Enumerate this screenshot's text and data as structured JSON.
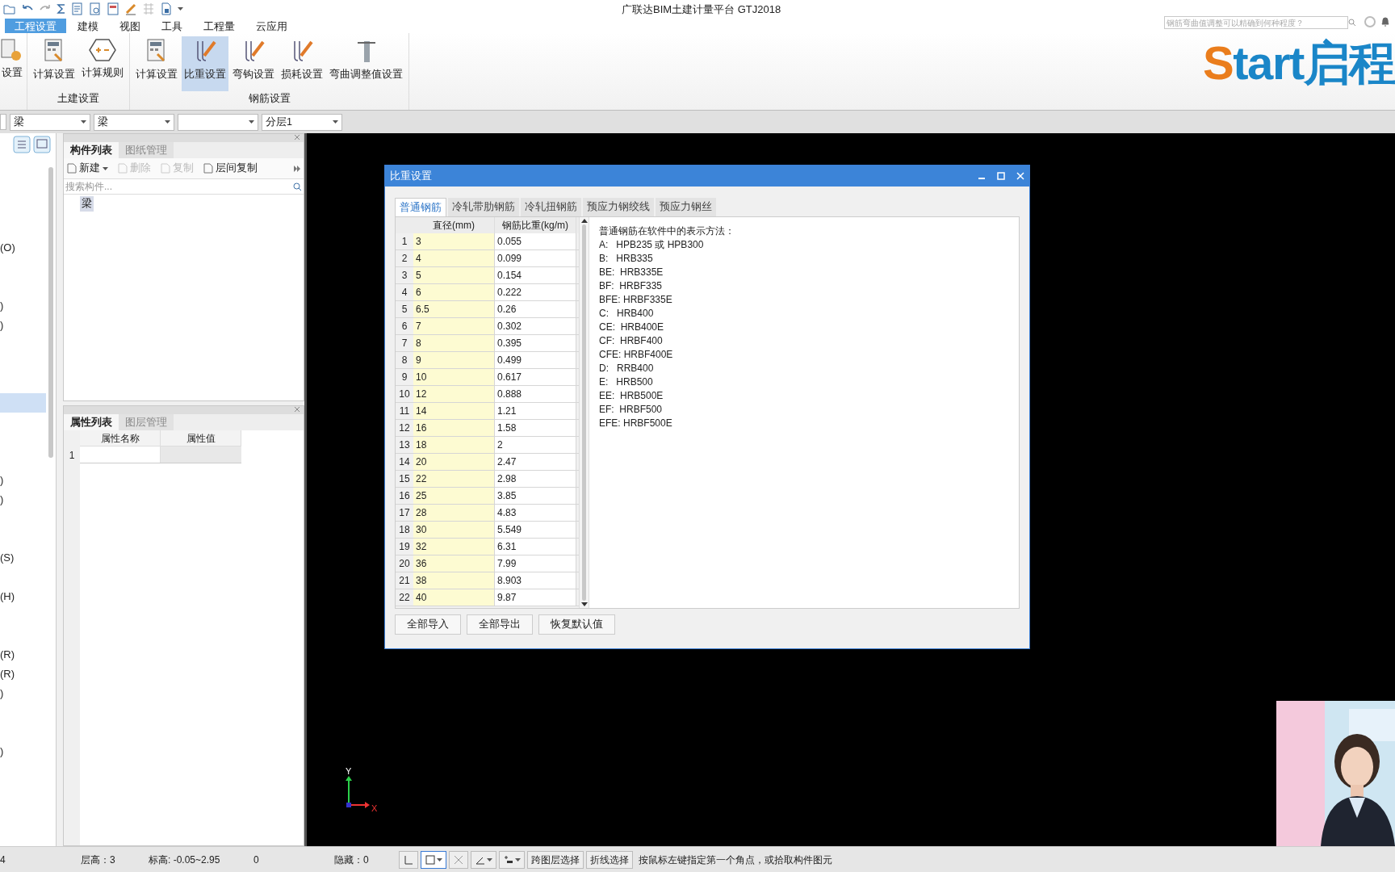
{
  "app_title": "广联达BIM土建计量平台 GTJ2018",
  "help_search": {
    "placeholder": "钢筋弯曲值调整可以精确到何种程度？"
  },
  "menu_tabs": [
    {
      "label": "工程设置",
      "selected": true
    },
    {
      "label": "建模",
      "selected": false
    },
    {
      "label": "视图",
      "selected": false
    },
    {
      "label": "工具",
      "selected": false
    },
    {
      "label": "工程量",
      "selected": false
    },
    {
      "label": "云应用",
      "selected": false
    }
  ],
  "ribbon_groups": [
    {
      "buttons": [
        {
          "label": "设置",
          "kind": "gear",
          "selected": false
        }
      ]
    },
    {
      "label": "土建设置",
      "buttons": [
        {
          "label": "计算设置",
          "kind": "calc",
          "selected": false
        },
        {
          "label": "计算规则",
          "kind": "rule",
          "selected": false
        }
      ]
    },
    {
      "label": "钢筋设置",
      "buttons": [
        {
          "label": "计算设置",
          "kind": "calc",
          "selected": false
        },
        {
          "label": "比重设置",
          "kind": "hook",
          "selected": true
        },
        {
          "label": "弯钩设置",
          "kind": "hook",
          "selected": false
        },
        {
          "label": "损耗设置",
          "kind": "hook",
          "selected": false
        },
        {
          "label": "弯曲调整值设置",
          "kind": "bend",
          "selected": false
        }
      ]
    }
  ],
  "logo_text": "Start启程",
  "combos": [
    {
      "kind": "filled",
      "value": "梁"
    },
    {
      "kind": "filled",
      "value": "梁"
    },
    {
      "kind": "blank"
    },
    {
      "kind": "filled",
      "value": "分层1"
    }
  ],
  "tree_rows": [
    {
      "selected": false
    },
    {
      "selected": false
    },
    {
      "selected": false
    },
    {
      "selected": false
    },
    {
      "text": "(O)",
      "selected": false
    },
    {
      "selected": false
    },
    {
      "selected": false
    },
    {
      "text": ")",
      "selected": false
    },
    {
      "text": ")",
      "selected": false
    },
    {
      "selected": false
    },
    {
      "selected": false
    },
    {
      "selected": false
    },
    {
      "selected": true
    },
    {
      "selected": false
    },
    {
      "selected": false
    },
    {
      "selected": false
    },
    {
      "text": ")",
      "selected": false
    },
    {
      "text": ")",
      "selected": false
    },
    {
      "selected": false
    },
    {
      "selected": false
    },
    {
      "text": "(S)",
      "selected": false
    },
    {
      "selected": false
    },
    {
      "text": "(H)",
      "selected": false
    },
    {
      "selected": false
    },
    {
      "selected": false
    },
    {
      "text": "(R)",
      "selected": false
    },
    {
      "text": "(R)",
      "selected": false
    },
    {
      "text": ")",
      "selected": false
    },
    {
      "selected": false
    },
    {
      "selected": false
    },
    {
      "text": ")",
      "selected": false
    }
  ],
  "component_panel": {
    "tabs": [
      {
        "label": "构件列表",
        "selected": true
      },
      {
        "label": "图纸管理",
        "selected": false
      }
    ],
    "tools": [
      {
        "label": "新建",
        "disabled": false,
        "dropdown": true
      },
      {
        "label": "删除",
        "disabled": true,
        "dropdown": false
      },
      {
        "label": "复制",
        "disabled": true,
        "dropdown": false
      },
      {
        "label": "层间复制",
        "disabled": false,
        "dropdown": false
      }
    ],
    "search": {
      "placeholder": "搜索构件..."
    },
    "items": [
      {
        "label": "梁",
        "selected": true
      }
    ]
  },
  "property_panel": {
    "tabs": [
      {
        "label": "属性列表",
        "selected": true
      },
      {
        "label": "图层管理",
        "selected": false
      }
    ],
    "columns": [
      "属性名称",
      "属性值"
    ],
    "rows": [
      "1"
    ]
  },
  "dialog": {
    "title": "比重设置",
    "tabs": [
      {
        "label": "普通钢筋",
        "selected": true
      },
      {
        "label": "冷轧带肋钢筋",
        "selected": false
      },
      {
        "label": "冷轧扭钢筋",
        "selected": false
      },
      {
        "label": "预应力钢绞线",
        "selected": false
      },
      {
        "label": "预应力钢丝",
        "selected": false
      }
    ],
    "columns": [
      "",
      "直径(mm)",
      "钢筋比重(kg/m)"
    ],
    "rows": [
      [
        "1",
        "3",
        "0.055"
      ],
      [
        "2",
        "4",
        "0.099"
      ],
      [
        "3",
        "5",
        "0.154"
      ],
      [
        "4",
        "6",
        "0.222"
      ],
      [
        "5",
        "6.5",
        "0.26"
      ],
      [
        "6",
        "7",
        "0.302"
      ],
      [
        "7",
        "8",
        "0.395"
      ],
      [
        "8",
        "9",
        "0.499"
      ],
      [
        "9",
        "10",
        "0.617"
      ],
      [
        "10",
        "12",
        "0.888"
      ],
      [
        "11",
        "14",
        "1.21"
      ],
      [
        "12",
        "16",
        "1.58"
      ],
      [
        "13",
        "18",
        "2"
      ],
      [
        "14",
        "20",
        "2.47"
      ],
      [
        "15",
        "22",
        "2.98"
      ],
      [
        "16",
        "25",
        "3.85"
      ],
      [
        "17",
        "28",
        "4.83"
      ],
      [
        "18",
        "30",
        "5.549"
      ],
      [
        "19",
        "32",
        "6.31"
      ],
      [
        "20",
        "36",
        "7.99"
      ],
      [
        "21",
        "38",
        "8.903"
      ],
      [
        "22",
        "40",
        "9.87"
      ]
    ],
    "notes": [
      "普通钢筋在软件中的表示方法：",
      "A:   HPB235 或 HPB300",
      "B:   HRB335",
      "BE:  HRB335E",
      "BF:  HRBF335",
      "BFE: HRBF335E",
      "C:   HRB400",
      "CE:  HRB400E",
      "CF:  HRBF400",
      "CFE: HRBF400E",
      "D:   RRB400",
      "E:   HRB500",
      "EE:  HRB500E",
      "EF:  HRBF500",
      "EFE: HRBF500E"
    ],
    "buttons": [
      "全部导入",
      "全部导出",
      "恢复默认值"
    ]
  },
  "axis_labels": [
    "Y",
    "X"
  ],
  "status_bar": {
    "cut_value": "4",
    "floor_height": "层高：3",
    "elevation": "标高: -0.05~2.95",
    "count": "0",
    "hidden": "隐藏：0",
    "buttons": [
      "跨图层选择",
      "折线选择"
    ],
    "message": "按鼠标左键指定第一个角点，或拾取构件图元"
  }
}
